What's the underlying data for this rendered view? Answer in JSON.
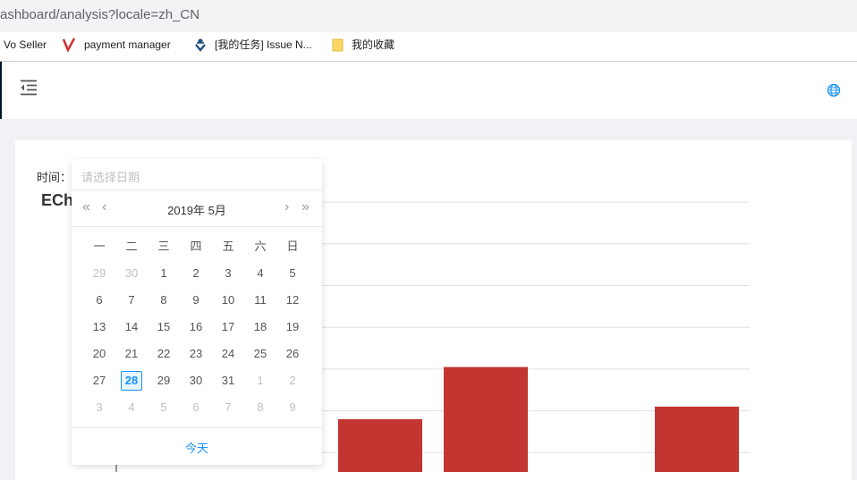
{
  "browser": {
    "url": "ashboard/analysis?locale=zh_CN",
    "bookmarks": [
      {
        "label": "Vo Seller",
        "icon": "none"
      },
      {
        "label": "payment manager",
        "icon": "v-logo-icon"
      },
      {
        "label": "[我的任务] Issue N...",
        "icon": "jira-icon"
      },
      {
        "label": "我的收藏",
        "icon": "folder-icon"
      }
    ]
  },
  "header": {
    "menu_icon": "menu-fold-icon",
    "lang_icon": "globe-icon"
  },
  "filter": {
    "time_label": "时间："
  },
  "chart_title": "ECh",
  "datepicker": {
    "placeholder": "请选择日期",
    "month_label": "2019年 5月",
    "prev_year": "«",
    "prev_month": "‹",
    "next_month": "›",
    "next_year": "»",
    "weekdays": [
      "一",
      "二",
      "三",
      "四",
      "五",
      "六",
      "日"
    ],
    "weeks": [
      [
        "29",
        "30",
        "1",
        "2",
        "3",
        "4",
        "5"
      ],
      [
        "6",
        "7",
        "8",
        "9",
        "10",
        "11",
        "12"
      ],
      [
        "13",
        "14",
        "15",
        "16",
        "17",
        "18",
        "19"
      ],
      [
        "20",
        "21",
        "22",
        "23",
        "24",
        "25",
        "26"
      ],
      [
        "27",
        "28",
        "29",
        "30",
        "31",
        "1",
        "2"
      ],
      [
        "3",
        "4",
        "5",
        "6",
        "7",
        "8",
        "9"
      ]
    ],
    "selected": "28",
    "today_label": "今天"
  },
  "colors": {
    "bar": "#c23531",
    "accent": "#1890ff"
  },
  "chart_data": {
    "type": "bar",
    "values": [
      5,
      5,
      36,
      61,
      10,
      42
    ],
    "ylim": [
      0,
      140
    ],
    "grid": true
  }
}
